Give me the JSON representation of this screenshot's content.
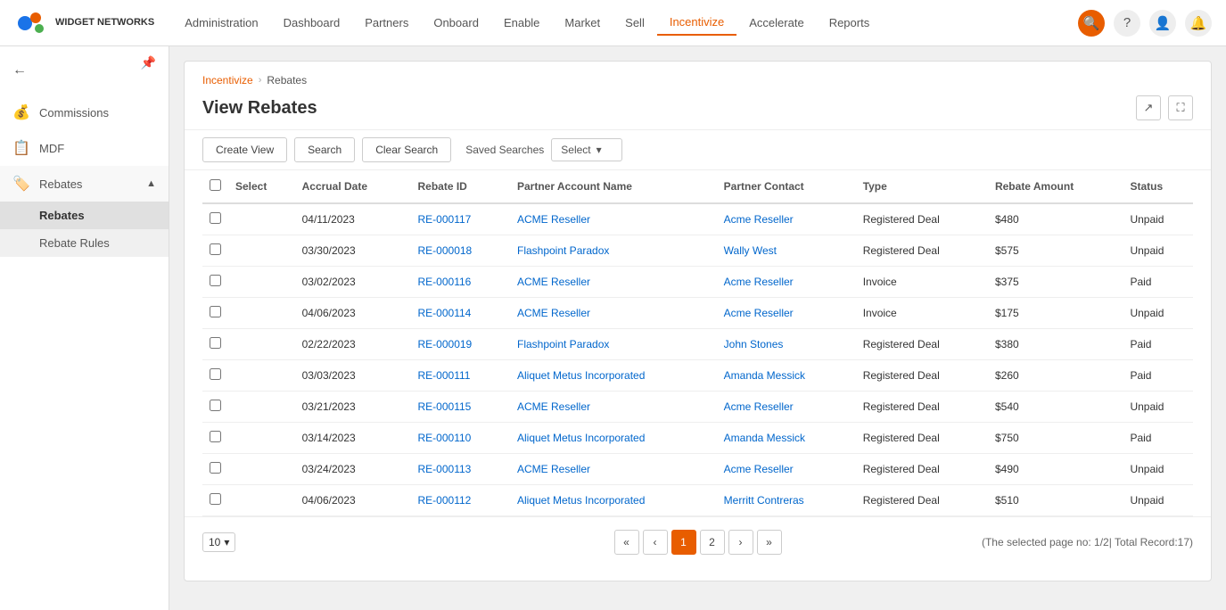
{
  "nav": {
    "logo_text": "WIDGET\nNETWORKS",
    "items": [
      {
        "label": "Administration",
        "active": false
      },
      {
        "label": "Dashboard",
        "active": false
      },
      {
        "label": "Partners",
        "active": false
      },
      {
        "label": "Onboard",
        "active": false
      },
      {
        "label": "Enable",
        "active": false
      },
      {
        "label": "Market",
        "active": false
      },
      {
        "label": "Sell",
        "active": false
      },
      {
        "label": "Incentivize",
        "active": true
      },
      {
        "label": "Accelerate",
        "active": false
      },
      {
        "label": "Reports",
        "active": false
      }
    ]
  },
  "sidebar": {
    "items": [
      {
        "id": "commissions",
        "label": "Commissions",
        "icon": "💰"
      },
      {
        "id": "mdf",
        "label": "MDF",
        "icon": "📋"
      },
      {
        "id": "rebates",
        "label": "Rebates",
        "icon": "🏷️",
        "expanded": true
      }
    ],
    "submenu": [
      {
        "id": "rebates-sub",
        "label": "Rebates",
        "active": true
      },
      {
        "id": "rebate-rules",
        "label": "Rebate Rules",
        "active": false
      }
    ]
  },
  "breadcrumb": {
    "parent": "Incentivize",
    "separator": "›",
    "current": "Rebates"
  },
  "page": {
    "title": "View Rebates"
  },
  "toolbar": {
    "create_view_label": "Create View",
    "search_label": "Search",
    "clear_search_label": "Clear Search",
    "saved_searches_label": "Saved Searches",
    "select_label": "Select"
  },
  "table": {
    "columns": [
      "Select",
      "Accrual Date",
      "Rebate ID",
      "Partner Account Name",
      "Partner Contact",
      "Type",
      "Rebate Amount",
      "Status"
    ],
    "rows": [
      {
        "accrual_date": "04/11/2023",
        "rebate_id": "RE-000117",
        "partner_account": "ACME Reseller",
        "partner_contact": "Acme Reseller",
        "type": "Registered Deal",
        "rebate_amount": "$480",
        "status": "Unpaid"
      },
      {
        "accrual_date": "03/30/2023",
        "rebate_id": "RE-000018",
        "partner_account": "Flashpoint Paradox",
        "partner_contact": "Wally West",
        "type": "Registered Deal",
        "rebate_amount": "$575",
        "status": "Unpaid"
      },
      {
        "accrual_date": "03/02/2023",
        "rebate_id": "RE-000116",
        "partner_account": "ACME Reseller",
        "partner_contact": "Acme Reseller",
        "type": "Invoice",
        "rebate_amount": "$375",
        "status": "Paid"
      },
      {
        "accrual_date": "04/06/2023",
        "rebate_id": "RE-000114",
        "partner_account": "ACME Reseller",
        "partner_contact": "Acme Reseller",
        "type": "Invoice",
        "rebate_amount": "$175",
        "status": "Unpaid"
      },
      {
        "accrual_date": "02/22/2023",
        "rebate_id": "RE-000019",
        "partner_account": "Flashpoint Paradox",
        "partner_contact": "John Stones",
        "type": "Registered Deal",
        "rebate_amount": "$380",
        "status": "Paid"
      },
      {
        "accrual_date": "03/03/2023",
        "rebate_id": "RE-000111",
        "partner_account": "Aliquet Metus Incorporated",
        "partner_contact": "Amanda Messick",
        "type": "Registered Deal",
        "rebate_amount": "$260",
        "status": "Paid"
      },
      {
        "accrual_date": "03/21/2023",
        "rebate_id": "RE-000115",
        "partner_account": "ACME Reseller",
        "partner_contact": "Acme Reseller",
        "type": "Registered Deal",
        "rebate_amount": "$540",
        "status": "Unpaid"
      },
      {
        "accrual_date": "03/14/2023",
        "rebate_id": "RE-000110",
        "partner_account": "Aliquet Metus Incorporated",
        "partner_contact": "Amanda Messick",
        "type": "Registered Deal",
        "rebate_amount": "$750",
        "status": "Paid"
      },
      {
        "accrual_date": "03/24/2023",
        "rebate_id": "RE-000113",
        "partner_account": "ACME Reseller",
        "partner_contact": "Acme Reseller",
        "type": "Registered Deal",
        "rebate_amount": "$490",
        "status": "Unpaid"
      },
      {
        "accrual_date": "04/06/2023",
        "rebate_id": "RE-000112",
        "partner_account": "Aliquet Metus Incorporated",
        "partner_contact": "Merritt Contreras",
        "type": "Registered Deal",
        "rebate_amount": "$510",
        "status": "Unpaid"
      }
    ]
  },
  "pagination": {
    "per_page": "10",
    "pages": [
      "<<",
      "<",
      "1",
      "2",
      ">",
      ">>"
    ],
    "current_page": "1",
    "page_info": "(The selected page no: 1/2| Total Record:17)"
  }
}
